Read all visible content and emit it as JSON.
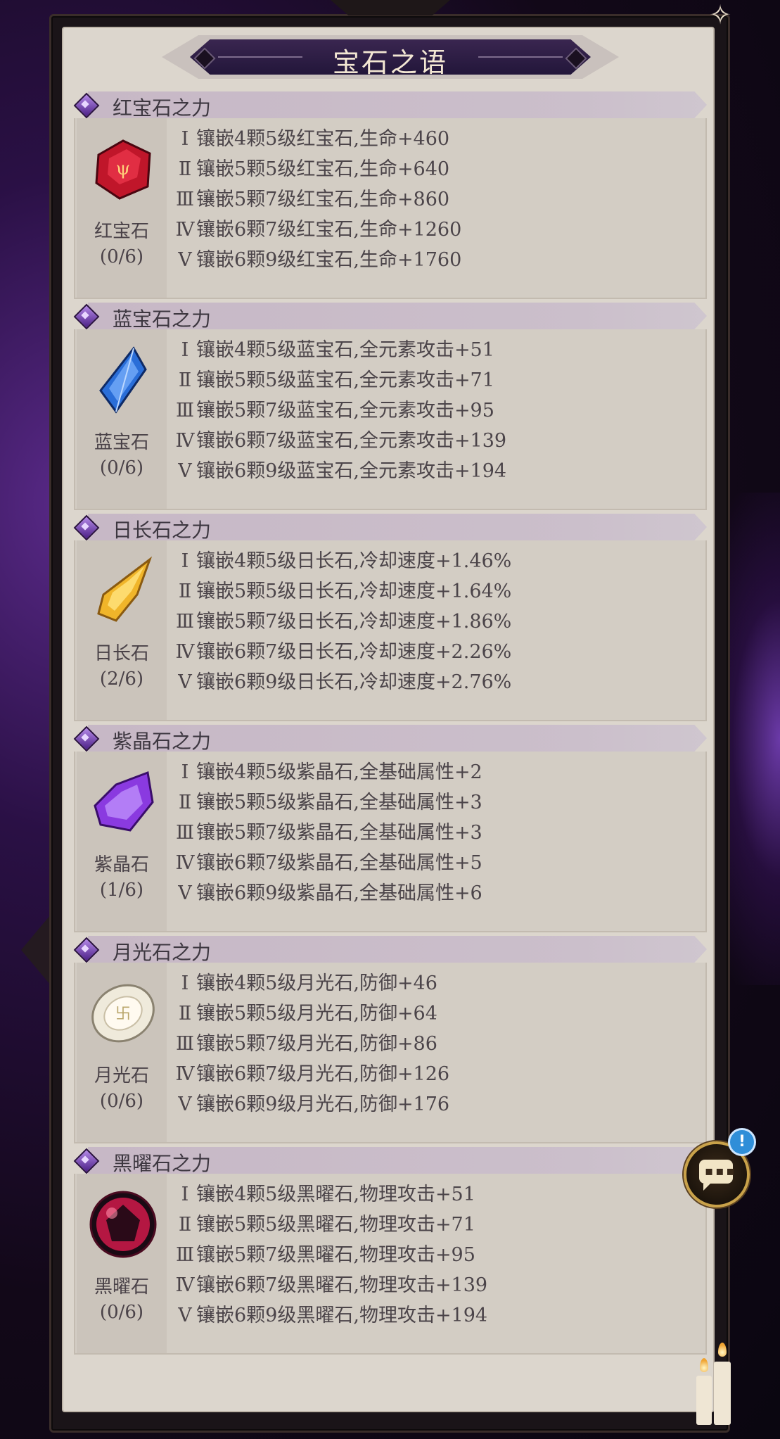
{
  "title": "宝石之语",
  "sections": [
    {
      "header": "红宝石之力",
      "gem": {
        "name": "红宝石",
        "count": "(0/6)",
        "icon": "ruby-icon",
        "color": "#c0162a"
      },
      "tiers": [
        {
          "rn": "Ⅰ",
          "text": "镶嵌4颗5级红宝石,生命+460"
        },
        {
          "rn": "Ⅱ",
          "text": "镶嵌5颗5级红宝石,生命+640"
        },
        {
          "rn": "Ⅲ",
          "text": "镶嵌5颗7级红宝石,生命+860"
        },
        {
          "rn": "Ⅳ",
          "text": "镶嵌6颗7级红宝石,生命+1260"
        },
        {
          "rn": "Ⅴ",
          "text": "镶嵌6颗9级红宝石,生命+1760"
        }
      ]
    },
    {
      "header": "蓝宝石之力",
      "gem": {
        "name": "蓝宝石",
        "count": "(0/6)",
        "icon": "sapphire-icon",
        "color": "#2a6ed8"
      },
      "tiers": [
        {
          "rn": "Ⅰ",
          "text": "镶嵌4颗5级蓝宝石,全元素攻击+51"
        },
        {
          "rn": "Ⅱ",
          "text": "镶嵌5颗5级蓝宝石,全元素攻击+71"
        },
        {
          "rn": "Ⅲ",
          "text": "镶嵌5颗7级蓝宝石,全元素攻击+95"
        },
        {
          "rn": "Ⅳ",
          "text": "镶嵌6颗7级蓝宝石,全元素攻击+139"
        },
        {
          "rn": "Ⅴ",
          "text": "镶嵌6颗9级蓝宝石,全元素攻击+194"
        }
      ]
    },
    {
      "header": "日长石之力",
      "gem": {
        "name": "日长石",
        "count": "(2/6)",
        "icon": "sunstone-icon",
        "color": "#f0b52a"
      },
      "tiers": [
        {
          "rn": "Ⅰ",
          "text": "镶嵌4颗5级日长石,冷却速度+1.46%"
        },
        {
          "rn": "Ⅱ",
          "text": "镶嵌5颗5级日长石,冷却速度+1.64%"
        },
        {
          "rn": "Ⅲ",
          "text": "镶嵌5颗7级日长石,冷却速度+1.86%"
        },
        {
          "rn": "Ⅳ",
          "text": "镶嵌6颗7级日长石,冷却速度+2.26%"
        },
        {
          "rn": "Ⅴ",
          "text": "镶嵌6颗9级日长石,冷却速度+2.76%"
        }
      ]
    },
    {
      "header": "紫晶石之力",
      "gem": {
        "name": "紫晶石",
        "count": "(1/6)",
        "icon": "amethyst-icon",
        "color": "#8a3ae0"
      },
      "tiers": [
        {
          "rn": "Ⅰ",
          "text": "镶嵌4颗5级紫晶石,全基础属性+2"
        },
        {
          "rn": "Ⅱ",
          "text": "镶嵌5颗5级紫晶石,全基础属性+3"
        },
        {
          "rn": "Ⅲ",
          "text": "镶嵌5颗7级紫晶石,全基础属性+3"
        },
        {
          "rn": "Ⅳ",
          "text": "镶嵌6颗7级紫晶石,全基础属性+5"
        },
        {
          "rn": "Ⅴ",
          "text": "镶嵌6颗9级紫晶石,全基础属性+6"
        }
      ]
    },
    {
      "header": "月光石之力",
      "gem": {
        "name": "月光石",
        "count": "(0/6)",
        "icon": "moonstone-icon",
        "color": "#efeadb"
      },
      "tiers": [
        {
          "rn": "Ⅰ",
          "text": "镶嵌4颗5级月光石,防御+46"
        },
        {
          "rn": "Ⅱ",
          "text": "镶嵌5颗5级月光石,防御+64"
        },
        {
          "rn": "Ⅲ",
          "text": "镶嵌5颗7级月光石,防御+86"
        },
        {
          "rn": "Ⅳ",
          "text": "镶嵌6颗7级月光石,防御+126"
        },
        {
          "rn": "Ⅴ",
          "text": "镶嵌6颗9级月光石,防御+176"
        }
      ]
    },
    {
      "header": "黑曜石之力",
      "gem": {
        "name": "黑曜石",
        "count": "(0/6)",
        "icon": "obsidian-icon",
        "color": "#d01a4a"
      },
      "tiers": [
        {
          "rn": "Ⅰ",
          "text": "镶嵌4颗5级黑曜石,物理攻击+51"
        },
        {
          "rn": "Ⅱ",
          "text": "镶嵌5颗5级黑曜石,物理攻击+71"
        },
        {
          "rn": "Ⅲ",
          "text": "镶嵌5颗7级黑曜石,物理攻击+95"
        },
        {
          "rn": "Ⅳ",
          "text": "镶嵌6颗7级黑曜石,物理攻击+139"
        },
        {
          "rn": "Ⅴ",
          "text": "镶嵌6颗9级黑曜石,物理攻击+194"
        }
      ]
    }
  ],
  "chat": {
    "badge": "!",
    "icon": "chat-icon"
  }
}
